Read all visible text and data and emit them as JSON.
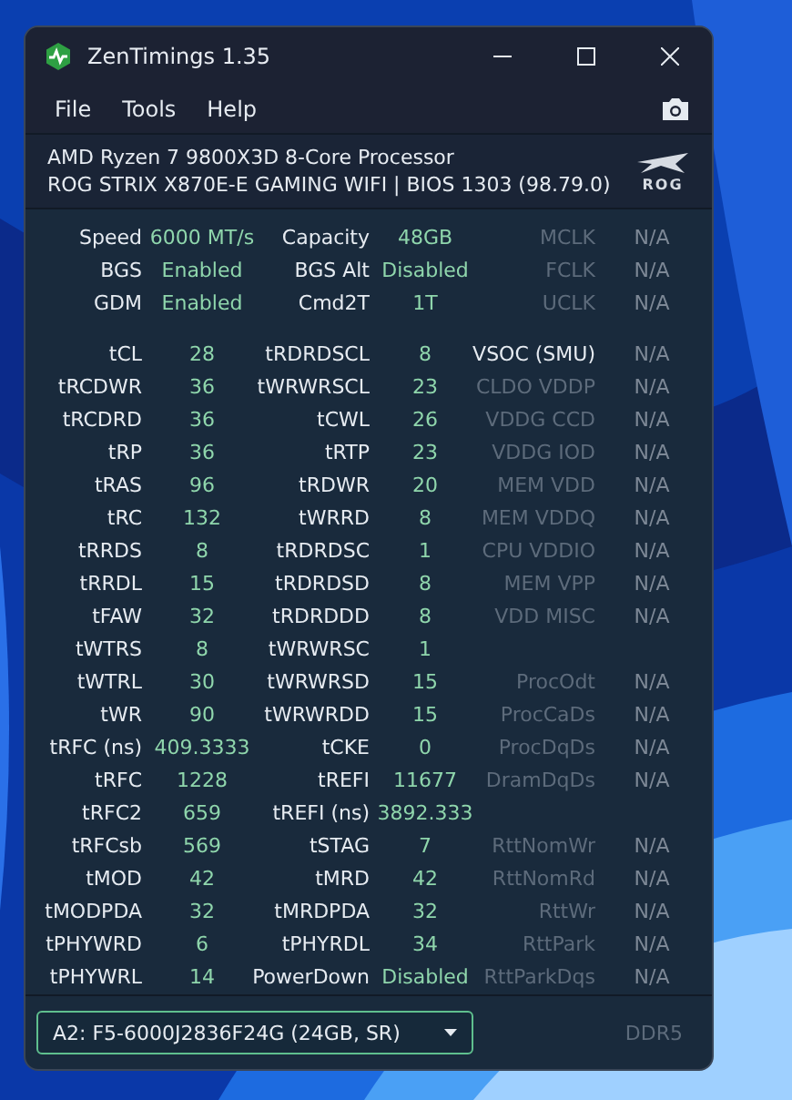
{
  "window": {
    "title": "ZenTimings 1.35"
  },
  "menu": [
    "File",
    "Tools",
    "Help"
  ],
  "system": {
    "cpu": "AMD Ryzen 7 9800X3D 8-Core Processor",
    "board": "ROG STRIX X870E-E GAMING WIFI | BIOS 1303 (98.79.0)",
    "logo_text": "ROG"
  },
  "summary": [
    {
      "c1": {
        "label": "Speed",
        "value": "6000 MT/s"
      },
      "c2": {
        "label": "Capacity",
        "value": "48GB"
      },
      "c3": {
        "label": "MCLK",
        "value": "N/A",
        "dimmed": true
      }
    },
    {
      "c1": {
        "label": "BGS",
        "value": "Enabled"
      },
      "c2": {
        "label": "BGS Alt",
        "value": "Disabled"
      },
      "c3": {
        "label": "FCLK",
        "value": "N/A",
        "dimmed": true
      }
    },
    {
      "c1": {
        "label": "GDM",
        "value": "Enabled"
      },
      "c2": {
        "label": "Cmd2T",
        "value": "1T"
      },
      "c3": {
        "label": "UCLK",
        "value": "N/A",
        "dimmed": true
      }
    }
  ],
  "timings": [
    {
      "c1": {
        "label": "tCL",
        "value": "28"
      },
      "c2": {
        "label": "tRDRDSCL",
        "value": "8"
      },
      "c3": {
        "label": "VSOC (SMU)",
        "value": "N/A",
        "dimmed": false
      }
    },
    {
      "c1": {
        "label": "tRCDWR",
        "value": "36"
      },
      "c2": {
        "label": "tWRWRSCL",
        "value": "23"
      },
      "c3": {
        "label": "CLDO VDDP",
        "value": "N/A",
        "dimmed": true
      }
    },
    {
      "c1": {
        "label": "tRCDRD",
        "value": "36"
      },
      "c2": {
        "label": "tCWL",
        "value": "26"
      },
      "c3": {
        "label": "VDDG CCD",
        "value": "N/A",
        "dimmed": true
      }
    },
    {
      "c1": {
        "label": "tRP",
        "value": "36"
      },
      "c2": {
        "label": "tRTP",
        "value": "23"
      },
      "c3": {
        "label": "VDDG IOD",
        "value": "N/A",
        "dimmed": true
      }
    },
    {
      "c1": {
        "label": "tRAS",
        "value": "96"
      },
      "c2": {
        "label": "tRDWR",
        "value": "20"
      },
      "c3": {
        "label": "MEM VDD",
        "value": "N/A",
        "dimmed": true
      }
    },
    {
      "c1": {
        "label": "tRC",
        "value": "132"
      },
      "c2": {
        "label": "tWRRD",
        "value": "8"
      },
      "c3": {
        "label": "MEM VDDQ",
        "value": "N/A",
        "dimmed": true
      }
    },
    {
      "c1": {
        "label": "tRRDS",
        "value": "8"
      },
      "c2": {
        "label": "tRDRDSC",
        "value": "1"
      },
      "c3": {
        "label": "CPU VDDIO",
        "value": "N/A",
        "dimmed": true
      }
    },
    {
      "c1": {
        "label": "tRRDL",
        "value": "15"
      },
      "c2": {
        "label": "tRDRDSD",
        "value": "8"
      },
      "c3": {
        "label": "MEM VPP",
        "value": "N/A",
        "dimmed": true
      }
    },
    {
      "c1": {
        "label": "tFAW",
        "value": "32"
      },
      "c2": {
        "label": "tRDRDDD",
        "value": "8"
      },
      "c3": {
        "label": "VDD MISC",
        "value": "N/A",
        "dimmed": true
      }
    },
    {
      "c1": {
        "label": "tWTRS",
        "value": "8"
      },
      "c2": {
        "label": "tWRWRSC",
        "value": "1"
      }
    },
    {
      "c1": {
        "label": "tWTRL",
        "value": "30"
      },
      "c2": {
        "label": "tWRWRSD",
        "value": "15"
      },
      "c3": {
        "label": "ProcOdt",
        "value": "N/A",
        "dimmed": true
      }
    },
    {
      "c1": {
        "label": "tWR",
        "value": "90"
      },
      "c2": {
        "label": "tWRWRDD",
        "value": "15"
      },
      "c3": {
        "label": "ProcCaDs",
        "value": "N/A",
        "dimmed": true
      }
    },
    {
      "c1": {
        "label": "tRFC (ns)",
        "value": "409.3333"
      },
      "c2": {
        "label": "tCKE",
        "value": "0"
      },
      "c3": {
        "label": "ProcDqDs",
        "value": "N/A",
        "dimmed": true
      }
    },
    {
      "c1": {
        "label": "tRFC",
        "value": "1228"
      },
      "c2": {
        "label": "tREFI",
        "value": "11677"
      },
      "c3": {
        "label": "DramDqDs",
        "value": "N/A",
        "dimmed": true
      }
    },
    {
      "c1": {
        "label": "tRFC2",
        "value": "659"
      },
      "c2": {
        "label": "tREFI (ns)",
        "value": "3892.333"
      }
    },
    {
      "c1": {
        "label": "tRFCsb",
        "value": "569"
      },
      "c2": {
        "label": "tSTAG",
        "value": "7"
      },
      "c3": {
        "label": "RttNomWr",
        "value": "N/A",
        "dimmed": true
      }
    },
    {
      "c1": {
        "label": "tMOD",
        "value": "42"
      },
      "c2": {
        "label": "tMRD",
        "value": "42"
      },
      "c3": {
        "label": "RttNomRd",
        "value": "N/A",
        "dimmed": true
      }
    },
    {
      "c1": {
        "label": "tMODPDA",
        "value": "32"
      },
      "c2": {
        "label": "tMRDPDA",
        "value": "32"
      },
      "c3": {
        "label": "RttWr",
        "value": "N/A",
        "dimmed": true
      }
    },
    {
      "c1": {
        "label": "tPHYWRD",
        "value": "6"
      },
      "c2": {
        "label": "tPHYRDL",
        "value": "34"
      },
      "c3": {
        "label": "RttPark",
        "value": "N/A",
        "dimmed": true
      }
    },
    {
      "c1": {
        "label": "tPHYWRL",
        "value": "14"
      },
      "c2": {
        "label": "PowerDown",
        "value": "Disabled"
      },
      "c3": {
        "label": "RttParkDqs",
        "value": "N/A",
        "dimmed": true
      }
    }
  ],
  "footer": {
    "module_select": {
      "value": "A2: F5-6000J2836F24G (24GB, SR)"
    },
    "memory_type": "DDR5"
  }
}
